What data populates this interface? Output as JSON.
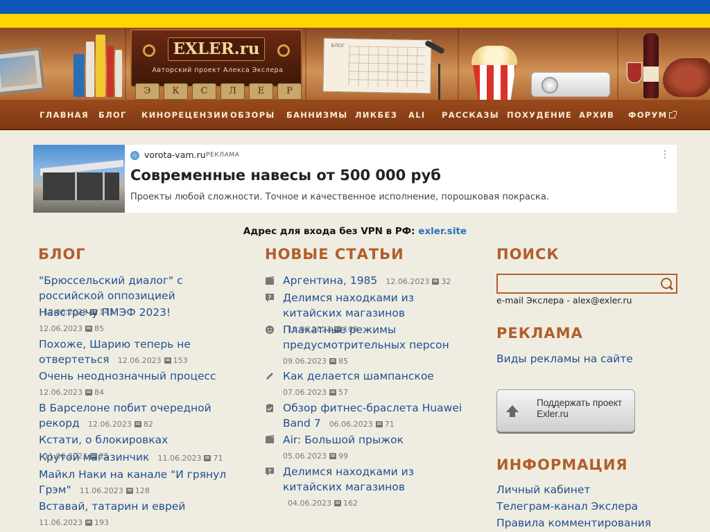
{
  "header": {
    "logo_title": "EXLER.ru",
    "logo_subtitle": "Авторский проект Алекса Экслера",
    "keys": [
      "Э",
      "К",
      "С",
      "Л",
      "Е",
      "Р"
    ],
    "calendar_label": "БЛОГ",
    "flag_colors": [
      "#0d57b7",
      "#ffd500"
    ]
  },
  "nav": {
    "items": [
      "ГЛАВНАЯ",
      "БЛОГ",
      "КИНОРЕЦЕНЗИИ",
      "ОБЗОРЫ",
      "БАННИЗМЫ",
      "ЛИКБЕЗ",
      "ALI",
      "РАССКАЗЫ",
      "ПОХУДЕНИЕ",
      "АРХИВ",
      "ФОРУМ"
    ]
  },
  "ad": {
    "domain": "vorota-vam.ru",
    "tag": "РЕКЛАМА",
    "title": "Современные навесы от 500 000 руб",
    "text": "Проекты любой сложности. Точное и качественное исполнение, порошковая покраска.",
    "menu": "⋮"
  },
  "vpn": {
    "label": "Адрес для входа без VPN в РФ:",
    "link": "exler.site"
  },
  "blog": {
    "heading": "БЛОГ",
    "items": [
      {
        "title": "\"Брюссельский диалог\" с российской оппозицией",
        "date": "12.06.2023",
        "comments": "143"
      },
      {
        "title": "Навстречу ПМЭФ 2023!",
        "date": "12.06.2023",
        "comments": "85"
      },
      {
        "title": "Похоже, Шарию теперь не отвертеться",
        "date": "12.06.2023",
        "comments": "153"
      },
      {
        "title": "Очень неоднозначный процесс",
        "date": "12.06.2023",
        "comments": "84"
      },
      {
        "title": "В Барселоне побит очередной рекорд",
        "date": "12.06.2023",
        "comments": "82"
      },
      {
        "title": "Кстати, о блокировках",
        "date": "11.06.2023",
        "comments": "25"
      },
      {
        "title": "Крутой магазинчик",
        "date": "11.06.2023",
        "comments": "71"
      },
      {
        "title": "Майкл Наки на канале \"И грянул Грэм\"",
        "date": "11.06.2023",
        "comments": "128"
      },
      {
        "title": "Вставай, татарин и еврей",
        "date": "11.06.2023",
        "comments": "193"
      }
    ]
  },
  "articles": {
    "heading": "НОВЫЕ СТАТЬИ",
    "items": [
      {
        "icon": "film-icon",
        "title": "Аргентина, 1985",
        "date": "12.06.2023",
        "comments": "32"
      },
      {
        "icon": "question-icon",
        "title": "Делимся находками из китайских магазинов",
        "date": "11.06.2023",
        "comments": "108"
      },
      {
        "icon": "smile-icon",
        "title": "Плакатные режимы предусмотрительных персон",
        "date": "09.06.2023",
        "comments": "85"
      },
      {
        "icon": "pencil-icon",
        "title": "Как делается шампанское",
        "date": "07.06.2023",
        "comments": "57"
      },
      {
        "icon": "checklist-icon",
        "title": "Обзор фитнес-браслета Huawei Band 7",
        "date": "06.06.2023",
        "comments": "71"
      },
      {
        "icon": "film-icon",
        "title": "Air: Большой прыжок",
        "date": "05.06.2023",
        "comments": "99"
      },
      {
        "icon": "question-icon",
        "title": "Делимся находками из китайских магазинов",
        "date": "04.06.2023",
        "comments": "162"
      }
    ]
  },
  "sidebar": {
    "search_heading": "ПОИСК",
    "search_value": "",
    "email_text": "e-mail Экслера - alex@exler.ru",
    "ads_heading": "РЕКЛАМА",
    "ads_link": "Виды рекламы на сайте",
    "support_line1": "Поддержать проект",
    "support_line2": "Exler.ru",
    "info_heading": "ИНФОРМАЦИЯ",
    "info_links": [
      "Личный кабинет",
      "Телеграм-канал Экслера",
      "Правила комментирования"
    ]
  },
  "colors": {
    "accent": "#b15e2a",
    "link": "#1e4f8f",
    "nav_bg": "#8a3f16",
    "page_bg": "#efede2"
  }
}
